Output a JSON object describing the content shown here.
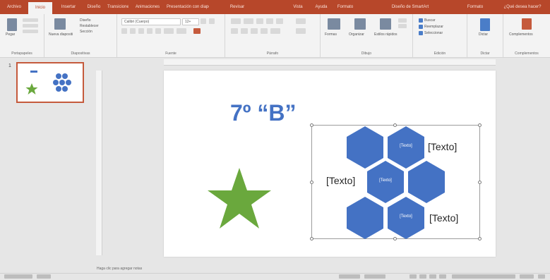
{
  "colors": {
    "accent": "#b7472a",
    "hex_fill": "#4472c4",
    "star_fill": "#6aa83d",
    "title_color": "#4472c4"
  },
  "tabs": [
    "Archivo",
    "Inicio",
    "Insertar",
    "Diseño",
    "Transiciones",
    "Animaciones",
    "Presentación con diapositivas",
    "Revisar",
    "Vista",
    "Ayuda",
    "Formato",
    "Diseño de SmartArt",
    "Formato",
    "¿Qué desea hacer?"
  ],
  "tabs_active_index": 1,
  "ribbon": {
    "groups": [
      {
        "label": "Portapapeles",
        "buttons": [
          "Pegar"
        ]
      },
      {
        "label": "Diapositivas",
        "buttons": [
          "Nueva diapositiva",
          "Diseño",
          "Restablecer",
          "Sección"
        ]
      },
      {
        "label": "Fuente",
        "buttons": [
          "Calibri (Cuerpo)",
          "12+"
        ]
      },
      {
        "label": "Párrafo",
        "buttons": []
      },
      {
        "label": "Dibujo",
        "buttons": [
          "Formas",
          "Organizar",
          "Estilos rápidos"
        ]
      },
      {
        "label": "Edición",
        "buttons": [
          "Buscar",
          "Reemplazar",
          "Seleccionar"
        ]
      },
      {
        "label": "Dictar",
        "buttons": [
          "Dictar"
        ]
      },
      {
        "label": "Complementos",
        "buttons": [
          "Complementos"
        ]
      }
    ]
  },
  "thumbnail": {
    "number": "1"
  },
  "slide": {
    "title": "7º “B”",
    "labels": {
      "top_right": "[Texto]",
      "middle_left": "[Texto]",
      "bottom_right": "[Texto]"
    },
    "hex_texts": [
      "[Texto]",
      "[Texto]",
      "[Texto]"
    ]
  },
  "notes_placeholder": "Haga clic para agregar notas"
}
